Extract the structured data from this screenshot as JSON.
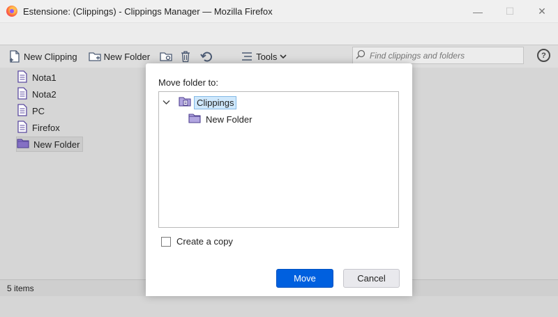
{
  "window": {
    "title": "Estensione: (Clippings) - Clippings Manager — Mozilla Firefox",
    "minimize": "—",
    "maximize": "☐",
    "close": "✕"
  },
  "toolbar": {
    "new_clipping": "New Clipping",
    "new_folder": "New Folder",
    "tools": "Tools",
    "search_placeholder": "Find clippings and folders",
    "help": "?"
  },
  "tree": {
    "items": [
      {
        "label": "Nota1",
        "icon": "clipping-icon"
      },
      {
        "label": "Nota2",
        "icon": "clipping-icon"
      },
      {
        "label": "PC",
        "icon": "clipping-icon"
      },
      {
        "label": "Firefox",
        "icon": "clipping-icon"
      },
      {
        "label": "New Folder",
        "icon": "folder-icon",
        "selected": true
      }
    ]
  },
  "status": {
    "count": "5 items"
  },
  "dialog": {
    "label": "Move folder to:",
    "folders": [
      {
        "label": "Clippings",
        "expanded": true,
        "selected": true
      },
      {
        "label": "New Folder"
      }
    ],
    "copy_label": "Create a copy",
    "copy_checked": false,
    "move_button": "Move",
    "cancel_button": "Cancel"
  },
  "colors": {
    "accent": "#0060df",
    "folder": "#8470c4",
    "selection": "#cfe8fc"
  }
}
